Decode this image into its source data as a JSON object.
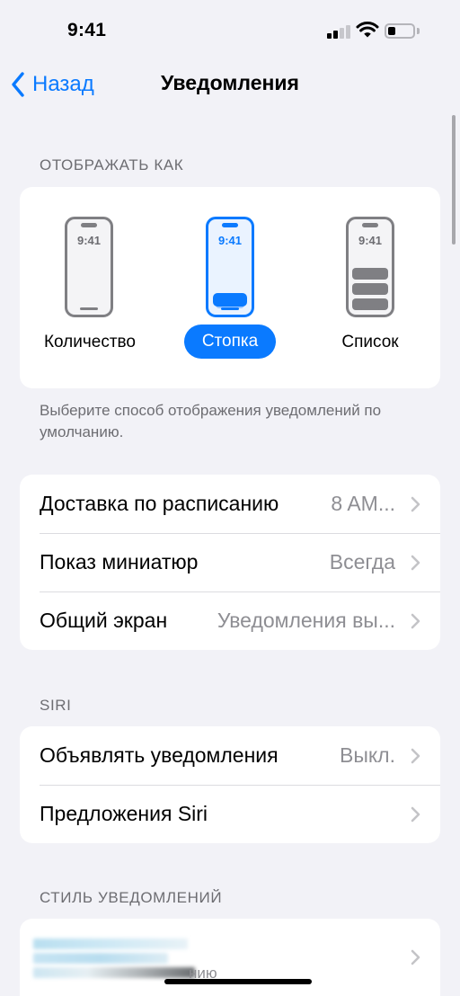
{
  "status_bar": {
    "time": "9:41"
  },
  "nav": {
    "back_label": "Назад",
    "title": "Уведомления"
  },
  "display_as": {
    "header": "ОТОБРАЖАТЬ КАК",
    "options": [
      {
        "label": "Количество",
        "phone_time": "9:41",
        "selected": false
      },
      {
        "label": "Стопка",
        "phone_time": "9:41",
        "selected": true
      },
      {
        "label": "Список",
        "phone_time": "9:41",
        "selected": false
      }
    ],
    "footer": "Выберите способ отображения уведомлений по умолчанию."
  },
  "settings_rows": [
    {
      "title": "Доставка по расписанию",
      "value": "8 AM..."
    },
    {
      "title": "Показ миниатюр",
      "value": "Всегда"
    },
    {
      "title": "Общий экран",
      "value": "Уведомления вы..."
    }
  ],
  "siri": {
    "header": "SIRI",
    "rows": [
      {
        "title": "Объявлять уведомления",
        "value": "Выкл."
      },
      {
        "title": "Предложения Siri",
        "value": ""
      }
    ]
  },
  "notification_style": {
    "header": "СТИЛЬ УВЕДОМЛЕНИЙ",
    "partial_row_text": "нию"
  },
  "colors": {
    "accent": "#0a7aff",
    "background": "#f2f2f7",
    "secondary_text": "#8e8e93",
    "section_text": "#6d6d72"
  }
}
